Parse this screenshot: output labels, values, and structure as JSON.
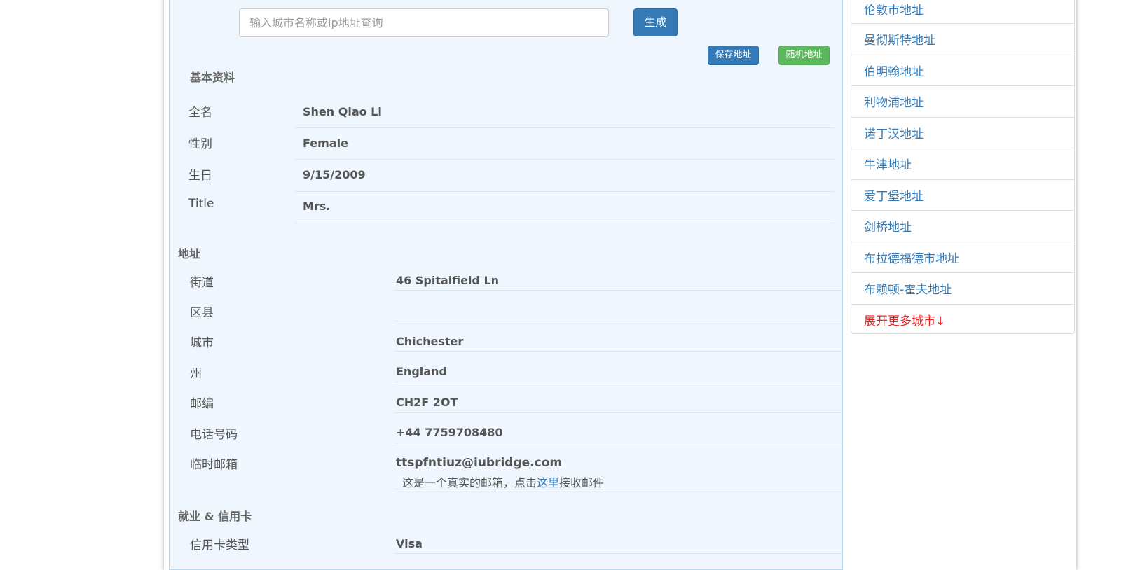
{
  "search": {
    "placeholder": "输入城市名称或ip地址查询"
  },
  "buttons": {
    "generate": "生成",
    "save_address": "保存地址",
    "random_address": "随机地址"
  },
  "basic_info": {
    "title": "基本资料",
    "rows": [
      {
        "label": "全名",
        "value": "Shen Qiao Li"
      },
      {
        "label": "性别",
        "value": "Female"
      },
      {
        "label": "生日",
        "value": "9/15/2009"
      },
      {
        "label": "Title",
        "value": "Mrs."
      }
    ]
  },
  "address": {
    "title": "地址",
    "rows": [
      {
        "label": "街道",
        "value": "46 Spitalfield Ln"
      },
      {
        "label": "区县",
        "value": ""
      },
      {
        "label": "城市",
        "value": "Chichester"
      },
      {
        "label": "州",
        "value": "England"
      },
      {
        "label": "邮编",
        "value": "CH2F 2OT"
      },
      {
        "label": "电话号码",
        "value": "+44 7759708480"
      },
      {
        "label": "临时邮箱",
        "value": "ttspfntiuz@iubridge.com"
      }
    ],
    "email_note": {
      "before": "这是一个真实的邮箱，点击",
      "link": "这里",
      "after": "接收邮件"
    }
  },
  "employment": {
    "title": "就业 & 信用卡",
    "rows": [
      {
        "label": "信用卡类型",
        "value": "Visa"
      }
    ]
  },
  "sidebar": {
    "cities": [
      "伦敦市地址",
      "曼彻斯特地址",
      "伯明翰地址",
      "利物浦地址",
      "诺丁汉地址",
      "牛津地址",
      "爱丁堡地址",
      "剑桥地址",
      "布拉德福德市地址",
      "布赖顿-霍夫地址"
    ],
    "more": "展开更多城市↓"
  },
  "colors": {
    "primary": "#337ab7",
    "success": "#5cb85c",
    "danger": "#e8221f",
    "panel_bg": "#eff6fd"
  }
}
